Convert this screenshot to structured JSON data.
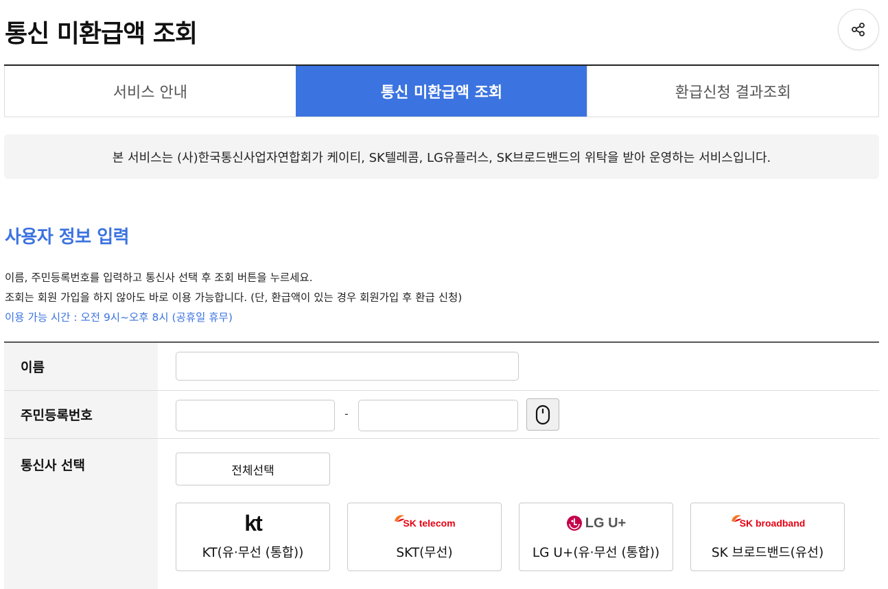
{
  "page": {
    "title": "통신 미환급액 조회"
  },
  "icons": {
    "share": "share-icon",
    "keypad": "mouse-keypad-icon"
  },
  "tabs": [
    {
      "label": "서비스 안내",
      "active": false
    },
    {
      "label": "통신 미환급액 조회",
      "active": true
    },
    {
      "label": "환급신청 결과조회",
      "active": false
    }
  ],
  "notice": "본 서비스는 (사)한국통신사업자연합회가 케이티, SK텔레콤, LG유플러스, SK브로드밴드의 위탁을 받아 운영하는 서비스입니다.",
  "section": {
    "title": "사용자 정보 입력",
    "desc1": "이름, 주민등록번호를 입력하고 통신사 선택 후 조회 버튼을 누르세요.",
    "desc2": "조회는 회원 가입을 하지 않아도 바로 이용 가능합니다. (단, 환급액이 있는 경우 회원가입 후 환급 신청)",
    "desc3": "이용 가능 시간 : 오전 9시~오후 8시 (공휴일 휴무)"
  },
  "form": {
    "name_label": "이름",
    "name_value": "",
    "rrn_label": "주민등록번호",
    "rrn_front_value": "",
    "rrn_back_value": "",
    "rrn_separator": "-",
    "carrier_label": "통신사 선택",
    "select_all_label": "전체선택",
    "carriers": [
      {
        "logo_text": "kt",
        "name": "KT(유·무선 (통합))"
      },
      {
        "logo_text": "SK telecom",
        "name": "SKT(무선)"
      },
      {
        "logo_text": "LG U+",
        "name": "LG U+(유·무선 (통합))"
      },
      {
        "logo_text": "SK broadband",
        "name": "SK 브로드밴드(유선)"
      }
    ]
  },
  "colors": {
    "accent": "#3b73e0",
    "sk_orange": "#f47725",
    "sk_red": "#e60012",
    "lg_red": "#c5004a",
    "kt_black": "#111111"
  }
}
